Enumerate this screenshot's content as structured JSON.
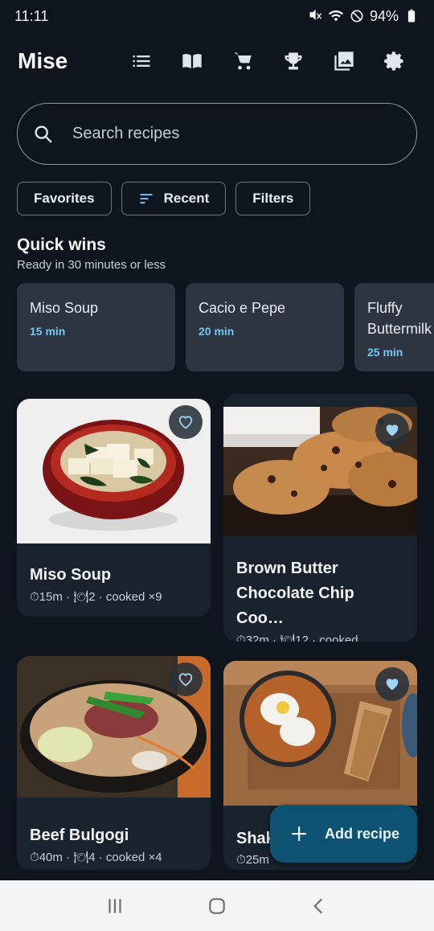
{
  "status": {
    "time": "11:11",
    "battery": "94%"
  },
  "app": {
    "title": "Mise"
  },
  "toolbar": {
    "icons": [
      "list-icon",
      "book-icon",
      "cart-icon",
      "trophy-icon",
      "gallery-icon",
      "settings-icon"
    ]
  },
  "search": {
    "placeholder": "Search recipes"
  },
  "chips": {
    "favorites": "Favorites",
    "recent": "Recent",
    "filters": "Filters"
  },
  "quick": {
    "title": "Quick wins",
    "subtitle": "Ready in 30 minutes or less",
    "items": [
      {
        "name": "Miso Soup",
        "time": "15 min"
      },
      {
        "name": "Cacio e Pepe",
        "time": "20 min"
      },
      {
        "name": "Fluffy Buttermilk Pancakes",
        "time": "25 min"
      }
    ]
  },
  "recipes": [
    {
      "name": "Miso Soup",
      "meta": "⏱15m · 🍽2 · cooked ×9",
      "favorite": false
    },
    {
      "name": "Brown Butter Chocolate Chip Coo…",
      "meta": "⏱32m · 🍽12 · cooked …",
      "favorite": true
    },
    {
      "name": "Beef Bulgogi",
      "meta": "⏱40m · 🍽4 · cooked ×4",
      "favorite": false
    },
    {
      "name": "Shakshuka",
      "meta": "⏱25m",
      "favorite": true
    }
  ],
  "fab": {
    "label": "Add recipe"
  },
  "colors": {
    "accent": "#7cc4f0",
    "fab": "#0e5272",
    "background": "#0e151c"
  }
}
